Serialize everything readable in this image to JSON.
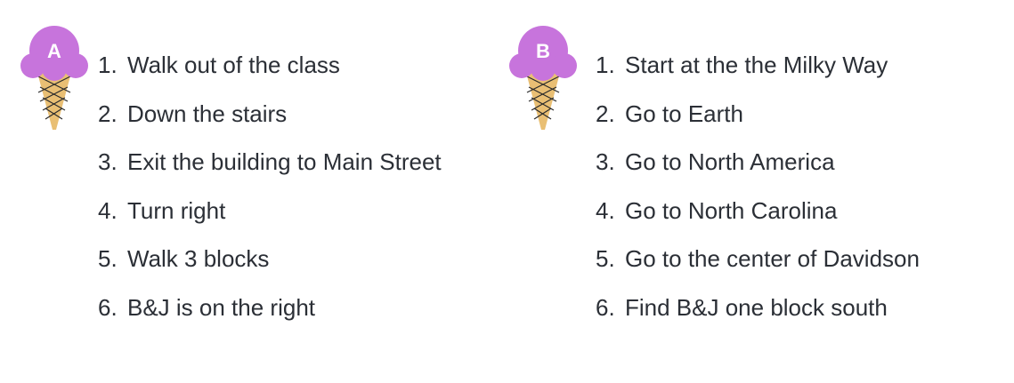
{
  "routes": [
    {
      "label": "A",
      "colors": {
        "scoop": "#c774dc",
        "cone": "#e9bf74",
        "lines": "#2b2b2b"
      },
      "steps": [
        {
          "num": "1.",
          "text": "Walk out of the class"
        },
        {
          "num": "2.",
          "text": "Down the stairs"
        },
        {
          "num": "3.",
          "text": "Exit the building to Main Street"
        },
        {
          "num": "4.",
          "text": "Turn right"
        },
        {
          "num": "5.",
          "text": "Walk 3 blocks"
        },
        {
          "num": "6.",
          "text": "B&J is on the right"
        }
      ]
    },
    {
      "label": "B",
      "colors": {
        "scoop": "#c774dc",
        "cone": "#e9bf74",
        "lines": "#2b2b2b"
      },
      "steps": [
        {
          "num": "1.",
          "text": "Start at the the Milky Way"
        },
        {
          "num": "2.",
          "text": "Go to Earth"
        },
        {
          "num": "3.",
          "text": "Go to North America"
        },
        {
          "num": "4.",
          "text": "Go to North Carolina"
        },
        {
          "num": "5.",
          "text": "Go to the center of Davidson"
        },
        {
          "num": "6.",
          "text": "Find B&J one block south"
        }
      ]
    }
  ]
}
